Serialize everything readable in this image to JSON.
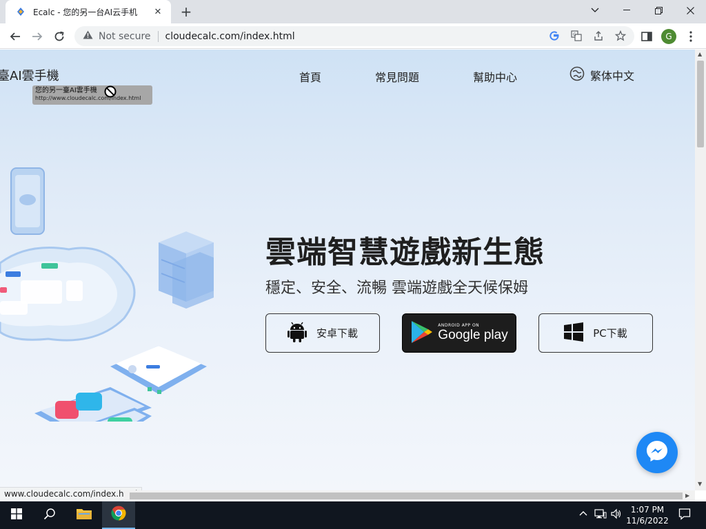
{
  "browser": {
    "tab_title": "Ecalc - 您的另一台AI云手机",
    "security_label": "Not secure",
    "url": "cloudecalc.com/index.html",
    "profile_initial": "G",
    "status_url": "www.cloudecalc.com/index.html"
  },
  "site": {
    "logo_text": "臺AI雲手機",
    "nav": {
      "home": "首頁",
      "faq": "常見問題",
      "help": "幫助中心",
      "language": "繁体中文"
    },
    "tooltip": {
      "title": "您的另一臺AI雲手機",
      "url": "http://www.cloudecalc.com/index.html"
    },
    "hero": {
      "title": "雲端智慧遊戲新生態",
      "subtitle": "穩定、安全、流暢 雲端遊戲全天候保姆"
    },
    "downloads": {
      "android_label": "安卓下載",
      "google_play_small": "ANDROID APP ON",
      "google_play_big": "Google play",
      "pc_label": "PC下載"
    }
  },
  "taskbar": {
    "time": "1:07 PM",
    "date": "11/6/2022"
  },
  "colors": {
    "accent_blue": "#1e88f5",
    "hero_bg": "#dfeaf7",
    "taskbar": "#10161f"
  }
}
